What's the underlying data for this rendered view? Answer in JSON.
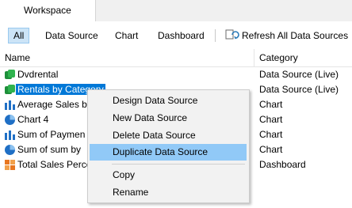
{
  "tab": {
    "label": "Workspace"
  },
  "toolbar": {
    "filters": [
      "All",
      "Data Source",
      "Chart",
      "Dashboard"
    ],
    "refresh_label": "Refresh All Data Sources"
  },
  "table": {
    "columns": [
      "Name",
      "Category"
    ],
    "rows": [
      {
        "name": "Dvdrental",
        "category": "Data Source (Live)",
        "icon": "database-icon"
      },
      {
        "name": "Rentals by Category",
        "category": "Data Source (Live)",
        "icon": "database-icon"
      },
      {
        "name": "Average Sales by",
        "category": "Chart",
        "icon": "bar-chart-icon"
      },
      {
        "name": "Chart 4",
        "category": "Chart",
        "icon": "pie-chart-icon"
      },
      {
        "name": "Sum of Paymen",
        "category": "Chart",
        "icon": "bar-chart-icon"
      },
      {
        "name": "Sum of sum by",
        "category": "Chart",
        "icon": "pie-chart-icon"
      },
      {
        "name": "Total Sales Perce",
        "category": "Dashboard",
        "icon": "dashboard-icon"
      }
    ]
  },
  "context_menu": {
    "items": [
      "Design Data Source",
      "New Data Source",
      "Delete Data Source",
      "Duplicate Data Source",
      "Copy",
      "Rename"
    ],
    "highlighted": "Duplicate Data Source"
  },
  "colors": {
    "selection": "#0078d7",
    "menu_highlight": "#91c9f7",
    "filter_active": "#cce4f7"
  }
}
